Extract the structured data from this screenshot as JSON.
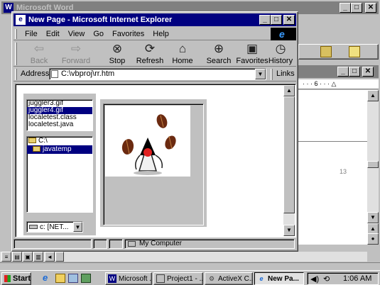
{
  "word": {
    "title": "Microsoft Word",
    "app_icon": "W"
  },
  "doc": {
    "ruler_text": "· · · 6 · · · △",
    "page_number": "13"
  },
  "ie": {
    "title": "New Page - Microsoft Internet Explorer",
    "menu": [
      "File",
      "Edit",
      "View",
      "Go",
      "Favorites",
      "Help"
    ],
    "toolbar": [
      {
        "label": "Back",
        "icon": "back-arrow-icon",
        "enabled": false
      },
      {
        "label": "Forward",
        "icon": "forward-arrow-icon",
        "enabled": false
      },
      {
        "label": "Stop",
        "icon": "stop-icon",
        "enabled": true
      },
      {
        "label": "Refresh",
        "icon": "refresh-icon",
        "enabled": true
      },
      {
        "label": "Home",
        "icon": "home-icon",
        "enabled": true
      },
      {
        "label": "Search",
        "icon": "search-globe-icon",
        "enabled": true
      },
      {
        "label": "Favorites",
        "icon": "favorites-folder-icon",
        "enabled": true
      },
      {
        "label": "History",
        "icon": "history-clock-icon",
        "enabled": true
      }
    ],
    "address_label": "Address",
    "address_value": "C:\\vbproj\\rr.htm",
    "links_label": "Links",
    "status_zone": "My Computer"
  },
  "page": {
    "file_list": [
      "juggler3.gif",
      "juggler4.gif",
      "localetest.class",
      "localetest.java"
    ],
    "file_list_selected": 1,
    "dir_list": [
      "C:\\",
      "javatemp"
    ],
    "dir_list_selected": 1,
    "drive_value": "c: [NET..."
  },
  "taskbar": {
    "start_label": "Start",
    "tasks": [
      {
        "label": "Microsoft ...",
        "icon": "word-icon"
      },
      {
        "label": "Project1 - ...",
        "icon": "vb-project-icon"
      },
      {
        "label": "ActiveX C...",
        "icon": "activex-icon"
      },
      {
        "label": "New Pa...",
        "icon": "ie-page-icon",
        "active": true
      }
    ],
    "clock": "1:06 AM"
  }
}
